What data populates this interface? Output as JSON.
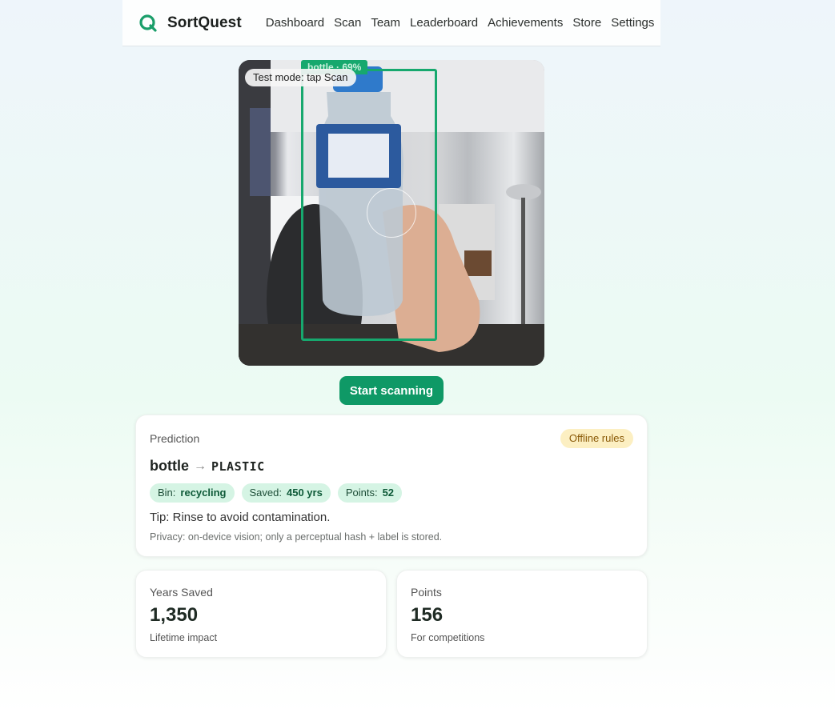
{
  "app": {
    "name": "SortQuest",
    "nav": [
      "Dashboard",
      "Scan",
      "Team",
      "Leaderboard",
      "Achievements",
      "Store",
      "Settings"
    ]
  },
  "camera": {
    "mode_chip": "Test mode: tap Scan",
    "detection_label": "bottle · 69%"
  },
  "actions": {
    "scan_button": "Start scanning"
  },
  "prediction": {
    "title": "Prediction",
    "badge": "Offline rules",
    "item": "bottle",
    "arrow": "→",
    "class": "PLASTIC",
    "pills": [
      {
        "label": "Bin:",
        "value": "recycling"
      },
      {
        "label": "Saved:",
        "value": "450 yrs"
      },
      {
        "label": "Points:",
        "value": "52"
      }
    ],
    "tip": "Tip: Rinse to avoid contamination.",
    "privacy": "Privacy: on-device vision; only a perceptual hash + label is stored."
  },
  "stats": {
    "years": {
      "label": "Years Saved",
      "value": "1,350",
      "sub": "Lifetime impact"
    },
    "points": {
      "label": "Points",
      "value": "156",
      "sub": "For competitions"
    }
  },
  "colors": {
    "accent": "#0f9966",
    "detection": "#17a86e",
    "pill_bg": "#d5f4e4",
    "badge_bg": "#fcefc2"
  }
}
